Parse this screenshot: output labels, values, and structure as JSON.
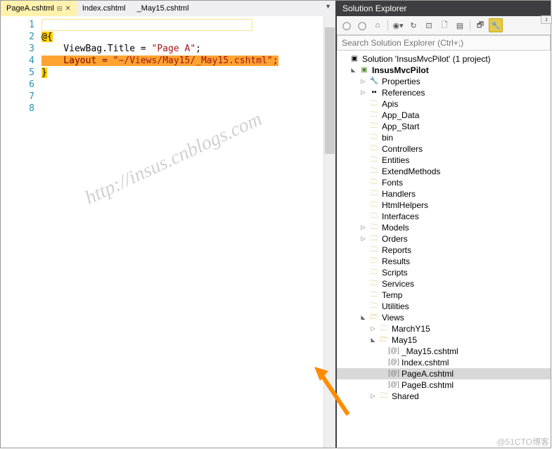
{
  "tabs": [
    {
      "label": "PageA.cshtml",
      "active": true,
      "pinned": true
    },
    {
      "label": "Index.cshtml",
      "active": false
    },
    {
      "label": "_May15.cshtml",
      "active": false
    }
  ],
  "code": {
    "lines": [
      "1",
      "2",
      "3",
      "4",
      "5",
      "6",
      "7",
      "8"
    ],
    "line2_open": "@{",
    "line3_pre": "    ViewBag.Title = ",
    "line3_str": "\"Page A\"",
    "line3_post": ";",
    "line4_pre": "    Layout = ",
    "line4_str": "\"~/Views/May15/_May15.cshtml\"",
    "line4_post": ";",
    "line5_close": "}"
  },
  "solution": {
    "header": "Solution Explorer",
    "search_placeholder": "Search Solution Explorer (Ctrl+;)",
    "root": "Solution 'InsusMvcPilot' (1 project)",
    "project": "InsusMvcPilot",
    "items": [
      "Properties",
      "References",
      "Apis",
      "App_Data",
      "App_Start",
      "bin",
      "Controllers",
      "Entities",
      "ExtendMethods",
      "Fonts",
      "Handlers",
      "HtmlHelpers",
      "Interfaces",
      "Models",
      "Orders",
      "Reports",
      "Results",
      "Scripts",
      "Services",
      "Temp",
      "Utilities"
    ],
    "views": "Views",
    "views_children": {
      "marchy15": "MarchY15",
      "may15": "May15",
      "may15_files": [
        "_May15.cshtml",
        "Index.cshtml",
        "PageA.cshtml",
        "PageB.cshtml"
      ],
      "shared": "Shared"
    },
    "selected_file": "PageA.cshtml"
  },
  "watermark": "http://insus.cnblogs.com",
  "credit": "@51CTO博客"
}
